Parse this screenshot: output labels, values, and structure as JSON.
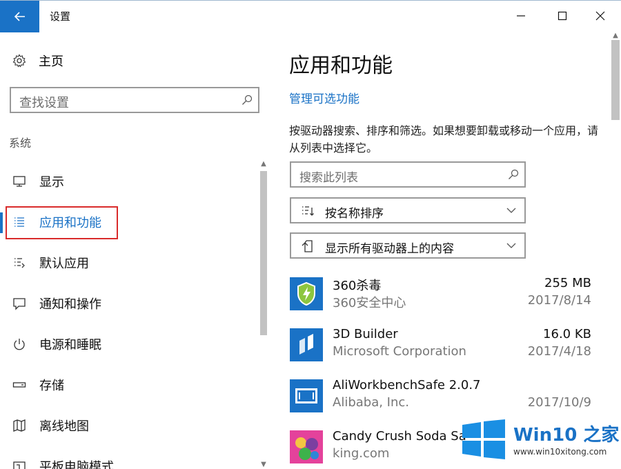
{
  "window": {
    "title": "设置",
    "controls": [
      "minimize",
      "maximize",
      "close"
    ]
  },
  "sidebar": {
    "home_label": "主页",
    "search_placeholder": "查找设置",
    "section_label": "系统",
    "items": [
      {
        "label": "显示",
        "icon": "monitor-icon"
      },
      {
        "label": "应用和功能",
        "icon": "apps-list-icon",
        "active": true
      },
      {
        "label": "默认应用",
        "icon": "default-apps-icon"
      },
      {
        "label": "通知和操作",
        "icon": "notification-icon"
      },
      {
        "label": "电源和睡眠",
        "icon": "power-icon"
      },
      {
        "label": "存储",
        "icon": "storage-icon"
      },
      {
        "label": "离线地图",
        "icon": "map-icon"
      },
      {
        "label": "平板电脑模式",
        "icon": "tablet-icon"
      }
    ]
  },
  "main": {
    "title": "应用和功能",
    "manage_link": "管理可选功能",
    "description": "按驱动器搜索、排序和筛选。如果想要卸载或移动一个应用，请从列表中选择它。",
    "list_search_placeholder": "搜索此列表",
    "sort_dropdown": "按名称排序",
    "drive_dropdown": "显示所有驱动器上的内容",
    "apps": [
      {
        "name": "360杀毒",
        "publisher": "360安全中心",
        "size": "255 MB",
        "date": "2017/8/14"
      },
      {
        "name": "3D Builder",
        "publisher": "Microsoft Corporation",
        "size": "16.0 KB",
        "date": "2017/4/18"
      },
      {
        "name": "AliWorkbenchSafe 2.0.7",
        "publisher": "Alibaba, Inc.",
        "size": "",
        "date": "2017/10/9"
      },
      {
        "name": "Candy Crush Soda Sa",
        "publisher": "king.com",
        "size": "",
        "date": ""
      }
    ]
  },
  "watermark": {
    "title": "Win10 之家",
    "url": "www.win10xitong.com"
  },
  "colors": {
    "accent": "#1a72c6",
    "highlight": "#d92b2b"
  }
}
